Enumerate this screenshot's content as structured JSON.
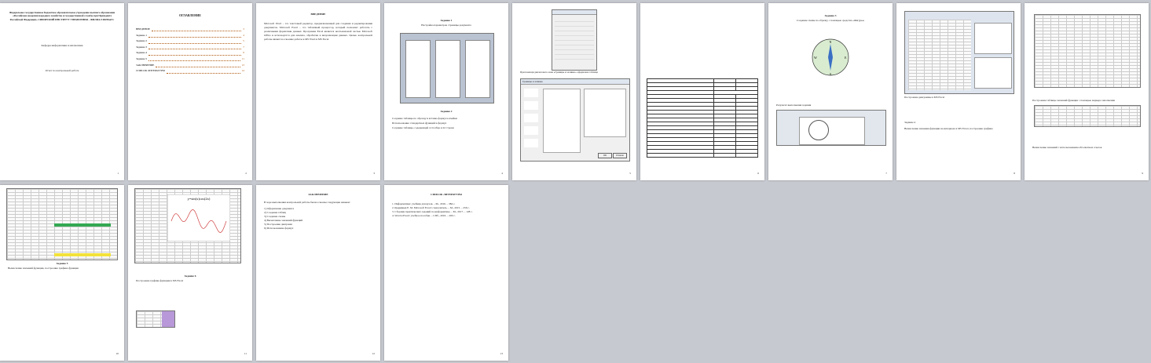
{
  "pages": {
    "p1": {
      "header": "Федеральное государственное бюджетное образовательное учреждение высшего образования «Российская академия народного хозяйства и государственной службы при Президенте Российской Федерации» СИБИРСКИЙ ИНСТИТУТ УПРАВЛЕНИЯ – ФИЛИАЛ РАНХиГС",
      "dept": "Кафедра информатики и математики",
      "work": "Отчет по контрольной работе",
      "num": "1"
    },
    "p2": {
      "title": "ОГЛАВЛЕНИЕ",
      "toc": [
        {
          "label": "ВВЕДЕНИЕ",
          "page": "3"
        },
        {
          "label": "Задание 1",
          "page": "4"
        },
        {
          "label": "Задание 2",
          "page": "5"
        },
        {
          "label": "Задание 3",
          "page": "7"
        },
        {
          "label": "Задание 4",
          "page": "9"
        },
        {
          "label": "Задание 5",
          "page": "11"
        },
        {
          "label": "ЗАКЛЮЧЕНИЕ",
          "page": "13"
        },
        {
          "label": "СПИСОК ЛИТЕРАТУРЫ",
          "page": "14"
        }
      ],
      "num": "2"
    },
    "p3": {
      "title": "ВВЕДЕНИЕ",
      "body": "Microsoft Word – это текстовый редактор, предназначенный для создания и редактирования документов. Microsoft Excel – это табличный процессор, который позволяет работать с различными форматами данных. Программа Excel является неотъемлемой частью Microsoft Office и используется для анализа, обработки и визуализации данных. Целью контрольной работы является освоение работы в MS Word и MS Excel.",
      "num": "3"
    },
    "p4": {
      "title": "Задание 1",
      "sub": "Настройка параметров страницы документа",
      "title2": "Задание 2",
      "items": [
        "Создание таблицы по образцу и вставка формул в ячейки",
        "Использование стандартных функций и формул",
        "Создание таблицы, содержащей 4 столбца и 22 строки"
      ],
      "num": "4"
    },
    "p5": {
      "caption": "При помощи диалогового окна «Границы и заливка» оформлена таблица",
      "dialog_title": "Границы и заливка",
      "btn_ok": "ОК",
      "btn_cancel": "Отмена",
      "num": "5"
    },
    "p6": {
      "num": "6"
    },
    "p7": {
      "title": "Задание 3",
      "sub": "Создание схемы по образцу с помощью средства «Фигуры»",
      "caption": "Результат выполнения задания",
      "compass": [
        "N",
        "W",
        "E",
        "S"
      ],
      "num": "7"
    },
    "p8": {
      "caption": "Построение диаграммы в MS Excel",
      "title": "Задание 4",
      "sub": "Вычисление значения функции на интервале в MS Excel, построение графика",
      "num": "8"
    },
    "p9": {
      "item1": "Построение таблицы значений функции с помощью маркера заполнения",
      "item2": "Вычисление значений с использованием абсолютных ссылок",
      "num": "9"
    },
    "p10": {
      "title": "Задание 5",
      "sub": "Вычисление значений функции, построение графика функции",
      "num": "10"
    },
    "p11": {
      "chart_title": "y=sin(x)cos(2x)",
      "title": "Задание 6",
      "sub": "Построение графика функции в MS Excel",
      "num": "11"
    },
    "p12": {
      "title": "ЗАКЛЮЧЕНИЕ",
      "intro": "В ходе выполнения контрольной работы были освоены следующие навыки:",
      "items": [
        "1) Оформление документа",
        "2) Создание таблиц",
        "3) Создание схемы",
        "4) Вычисление значений функций",
        "5) Построение диаграмм",
        "6) Использование формул"
      ],
      "num": "12"
    },
    "p13": {
      "title": "СПИСОК ЛИТЕРАТУРЫ",
      "refs": [
        "1. Информатика: учебник для вузов. – М., 2016. – 384 с.",
        "2. Кудрявцев Е. М. Microsoft Excel: самоучитель. – М., 2015. – 256 с.",
        "3. Сборник практических заданий по информатике. – М., 2017. – 128 с.",
        "4. Word и Excel: учебное пособие. – СПб., 2016. – 200 с."
      ],
      "num": "13"
    }
  }
}
